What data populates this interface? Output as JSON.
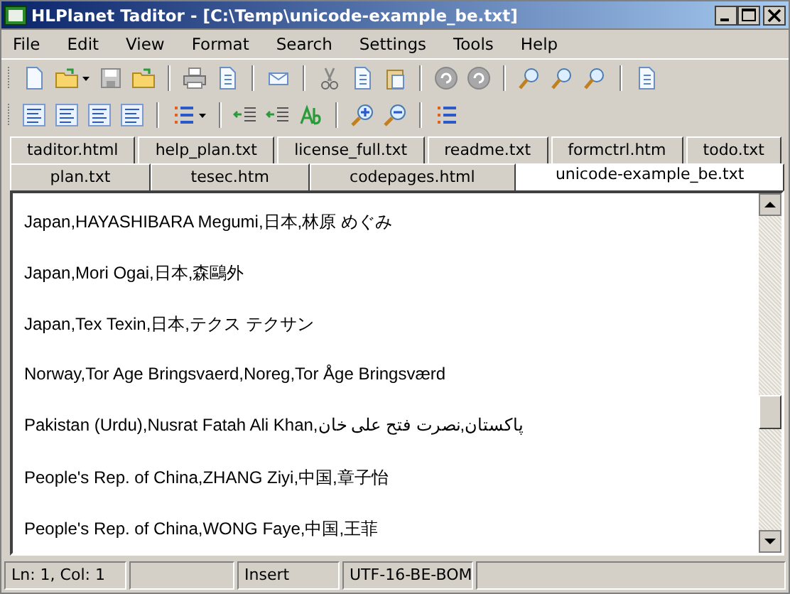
{
  "window": {
    "title": "HLPlanet Taditor - [C:\\Temp\\unicode-example_be.txt]"
  },
  "menu": [
    "File",
    "Edit",
    "View",
    "Format",
    "Search",
    "Settings",
    "Tools",
    "Help"
  ],
  "tab_rows": [
    [
      {
        "label": "taditor.html",
        "selected": false
      },
      {
        "label": "help_plan.txt",
        "selected": false
      },
      {
        "label": "license_full.txt",
        "selected": false
      },
      {
        "label": "readme.txt",
        "selected": false
      },
      {
        "label": "formctrl.htm",
        "selected": false
      },
      {
        "label": "todo.txt",
        "selected": false
      }
    ],
    [
      {
        "label": "plan.txt",
        "selected": false
      },
      {
        "label": "tesec.htm",
        "selected": false
      },
      {
        "label": "codepages.html",
        "selected": false
      },
      {
        "label": "unicode-example_be.txt",
        "selected": true
      }
    ]
  ],
  "editor": {
    "lines": [
      "Japan,HAYASHIBARA Megumi,日本,林原 めぐみ",
      "Japan,Mori Ogai,日本,森鷗外",
      "Japan,Tex Texin,日本,テクス テクサン",
      "Norway,Tor Age Bringsvaerd,Noreg,Tor Åge Bringsværd",
      "Pakistan (Urdu),Nusrat Fatah Ali Khan,پاکستان,نصرت فتح علی خان",
      "People's Rep. of China,ZHANG Ziyi,中国,章子怡",
      "People's Rep. of China,WONG Faye,中国,王菲"
    ]
  },
  "status_bar": {
    "position": "Ln: 1, Col: 1",
    "mode": "Insert",
    "encoding": "UTF-16-BE-BOM"
  }
}
